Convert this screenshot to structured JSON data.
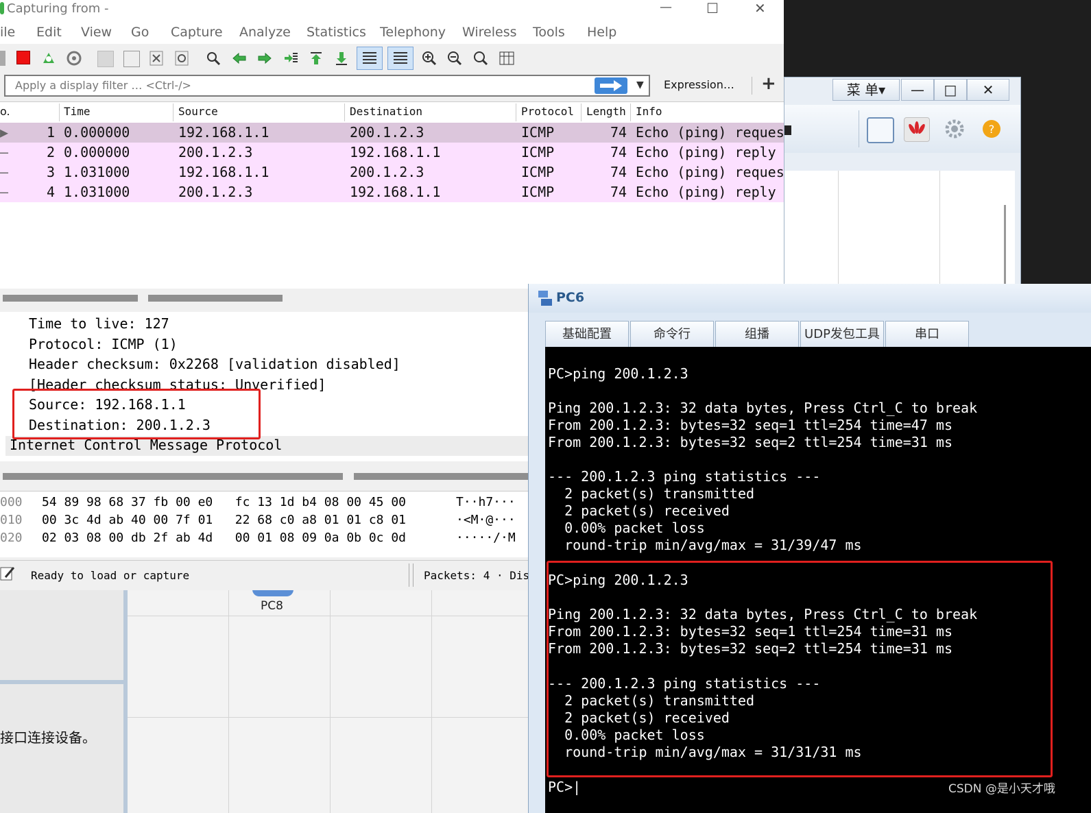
{
  "wireshark": {
    "title": "Capturing from -",
    "window_controls": {
      "minimize": "—",
      "maximize": "☐",
      "close": "✕"
    },
    "menu": [
      "ile",
      "Edit",
      "View",
      "Go",
      "Capture",
      "Analyze",
      "Statistics",
      "Telephony",
      "Wireless",
      "Tools",
      "Help"
    ],
    "filter": {
      "placeholder": "Apply a display filter … <Ctrl-/>",
      "expression_label": "Expression…",
      "plus": "+"
    },
    "columns": [
      "o.",
      "Time",
      "Source",
      "Destination",
      "Protocol",
      "Length",
      "Info"
    ],
    "packets": [
      {
        "no": "1",
        "time": "0.000000",
        "source": "192.168.1.1",
        "destination": "200.1.2.3",
        "protocol": "ICMP",
        "length": "74",
        "info": "Echo (ping) reques",
        "marker": "▶"
      },
      {
        "no": "2",
        "time": "0.000000",
        "source": "200.1.2.3",
        "destination": "192.168.1.1",
        "protocol": "ICMP",
        "length": "74",
        "info": "Echo (ping) reply",
        "marker": "–"
      },
      {
        "no": "3",
        "time": "1.031000",
        "source": "192.168.1.1",
        "destination": "200.1.2.3",
        "protocol": "ICMP",
        "length": "74",
        "info": "Echo (ping) reques",
        "marker": "–"
      },
      {
        "no": "4",
        "time": "1.031000",
        "source": "200.1.2.3",
        "destination": "192.168.1.1",
        "protocol": "ICMP",
        "length": "74",
        "info": "Echo (ping) reply",
        "marker": "–"
      }
    ],
    "details": [
      "Time to live: 127",
      "Protocol: ICMP (1)",
      "Header checksum: 0x2268 [validation disabled]",
      "[Header checksum status: Unverified]",
      "Source: 192.168.1.1",
      "Destination: 200.1.2.3",
      "Internet Control Message Protocol"
    ],
    "hex": [
      {
        "offset": "000",
        "bytes": "54 89 98 68 37 fb 00 e0   fc 13 1d b4 08 00 45 00",
        "ascii": "T··h7···"
      },
      {
        "offset": "010",
        "bytes": "00 3c 4d ab 40 00 7f 01   22 68 c0 a8 01 01 c8 01",
        "ascii": "·<M·@···"
      },
      {
        "offset": "020",
        "bytes": "02 03 08 00 db 2f ab 4d   00 01 08 09 0a 0b 0c 0d",
        "ascii": "·····/·M"
      }
    ],
    "status": {
      "ready": "Ready to load or capture",
      "packets": "Packets: 4 · Dis"
    }
  },
  "ensp": {
    "menu_button": "菜 单▾",
    "minimize": "—",
    "restore": "□",
    "close": "✕",
    "canvas_label": "PC8",
    "hint_text": "接口连接设备。"
  },
  "pc6": {
    "title": "PC6",
    "tabs": [
      "基础配置",
      "命令行",
      "组播",
      "UDP发包工具",
      "串口"
    ],
    "terminal": [
      "PC>ping 200.1.2.3",
      "",
      "Ping 200.1.2.3: 32 data bytes, Press Ctrl_C to break",
      "From 200.1.2.3: bytes=32 seq=1 ttl=254 time=47 ms",
      "From 200.1.2.3: bytes=32 seq=2 ttl=254 time=31 ms",
      "",
      "--- 200.1.2.3 ping statistics ---",
      "  2 packet(s) transmitted",
      "  2 packet(s) received",
      "  0.00% packet loss",
      "  round-trip min/avg/max = 31/39/47 ms",
      "",
      "PC>ping 200.1.2.3",
      "",
      "Ping 200.1.2.3: 32 data bytes, Press Ctrl_C to break",
      "From 200.1.2.3: bytes=32 seq=1 ttl=254 time=31 ms",
      "From 200.1.2.3: bytes=32 seq=2 ttl=254 time=31 ms",
      "",
      "--- 200.1.2.3 ping statistics ---",
      "  2 packet(s) transmitted",
      "  2 packet(s) received",
      "  0.00% packet loss",
      "  round-trip min/avg/max = 31/31/31 ms",
      "",
      "PC>|"
    ]
  },
  "watermark": "CSDN @是小天才哦",
  "colors": {
    "row_selected": "#dcc6dc",
    "row_icmp": "#fce0ff",
    "highlight": "#e0201e",
    "terminal_bg": "#000000"
  }
}
